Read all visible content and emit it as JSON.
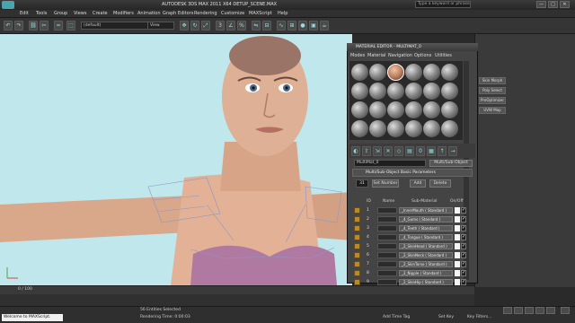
{
  "window": {
    "title": "AUTODESK 3DS MAX  2011 X64      DETUP_SCENE.MAX",
    "help_placeholder": "Type a keyword or phrase",
    "controls": [
      "—",
      "□",
      "✕"
    ]
  },
  "menubar": {
    "items": [
      "Edit",
      "Tools",
      "Group",
      "Views",
      "Create",
      "Modifiers",
      "Animation",
      "Graph Editors",
      "Rendering",
      "Customize",
      "MAXScript",
      "Help"
    ]
  },
  "toolbar": {
    "selection_filter": "(default)",
    "reference_coord": "View"
  },
  "viewport": {
    "background": "#bfe7ec",
    "label": "+ Perspective"
  },
  "command_panel": {
    "buttons": [
      "Skin Morph",
      "Poly Select",
      "ProOptimizer",
      "UVW Map"
    ]
  },
  "material_editor": {
    "title": "MATERIAL EDITOR - MULTIMAT_0",
    "menu": [
      "Modes",
      "Material",
      "Navigation",
      "Options",
      "Utilities"
    ],
    "material_name": "MultiMat_0",
    "material_type": "Multi/Sub-Object",
    "rollout_title": "Multi/Sub-Object Basic Parameters",
    "count": "31",
    "set_number_label": "Set Number",
    "add_label": "Add",
    "delete_label": "Delete",
    "col_id": "ID",
    "col_name": "Name",
    "col_sub": "Sub-Material",
    "col_onoff": "On/Off",
    "rows": [
      {
        "id": "1",
        "sub": "_InnerMouth  ( Standard )"
      },
      {
        "id": "2",
        "sub": "_4_Gums  ( Standard )"
      },
      {
        "id": "3",
        "sub": "_4_Teeth  ( Standard )"
      },
      {
        "id": "4",
        "sub": "_4_Tongue  ( Standard )"
      },
      {
        "id": "5",
        "sub": "_2_SkinHead  ( Standard )"
      },
      {
        "id": "6",
        "sub": "_2_SkinNeck  ( Standard )"
      },
      {
        "id": "7",
        "sub": "_2_SkinTorso  ( Standard )"
      },
      {
        "id": "8",
        "sub": "_2_Nipple  ( Standard )"
      },
      {
        "id": "9",
        "sub": "_2_SkinHip  ( Standard )"
      },
      {
        "id": "10",
        "sub": "_2_SkinArm  ( Standard )"
      }
    ]
  },
  "timeline": {
    "frame_label": "0 / 100"
  },
  "status": {
    "listener": "Welcome to MAXScript.",
    "selection": "56 Entities Selected",
    "render_time": "Rendering Time: 0:00:03",
    "add_time_tag": "Add Time Tag",
    "set_key": "Set Key",
    "key_filters": "Key Filters..."
  }
}
